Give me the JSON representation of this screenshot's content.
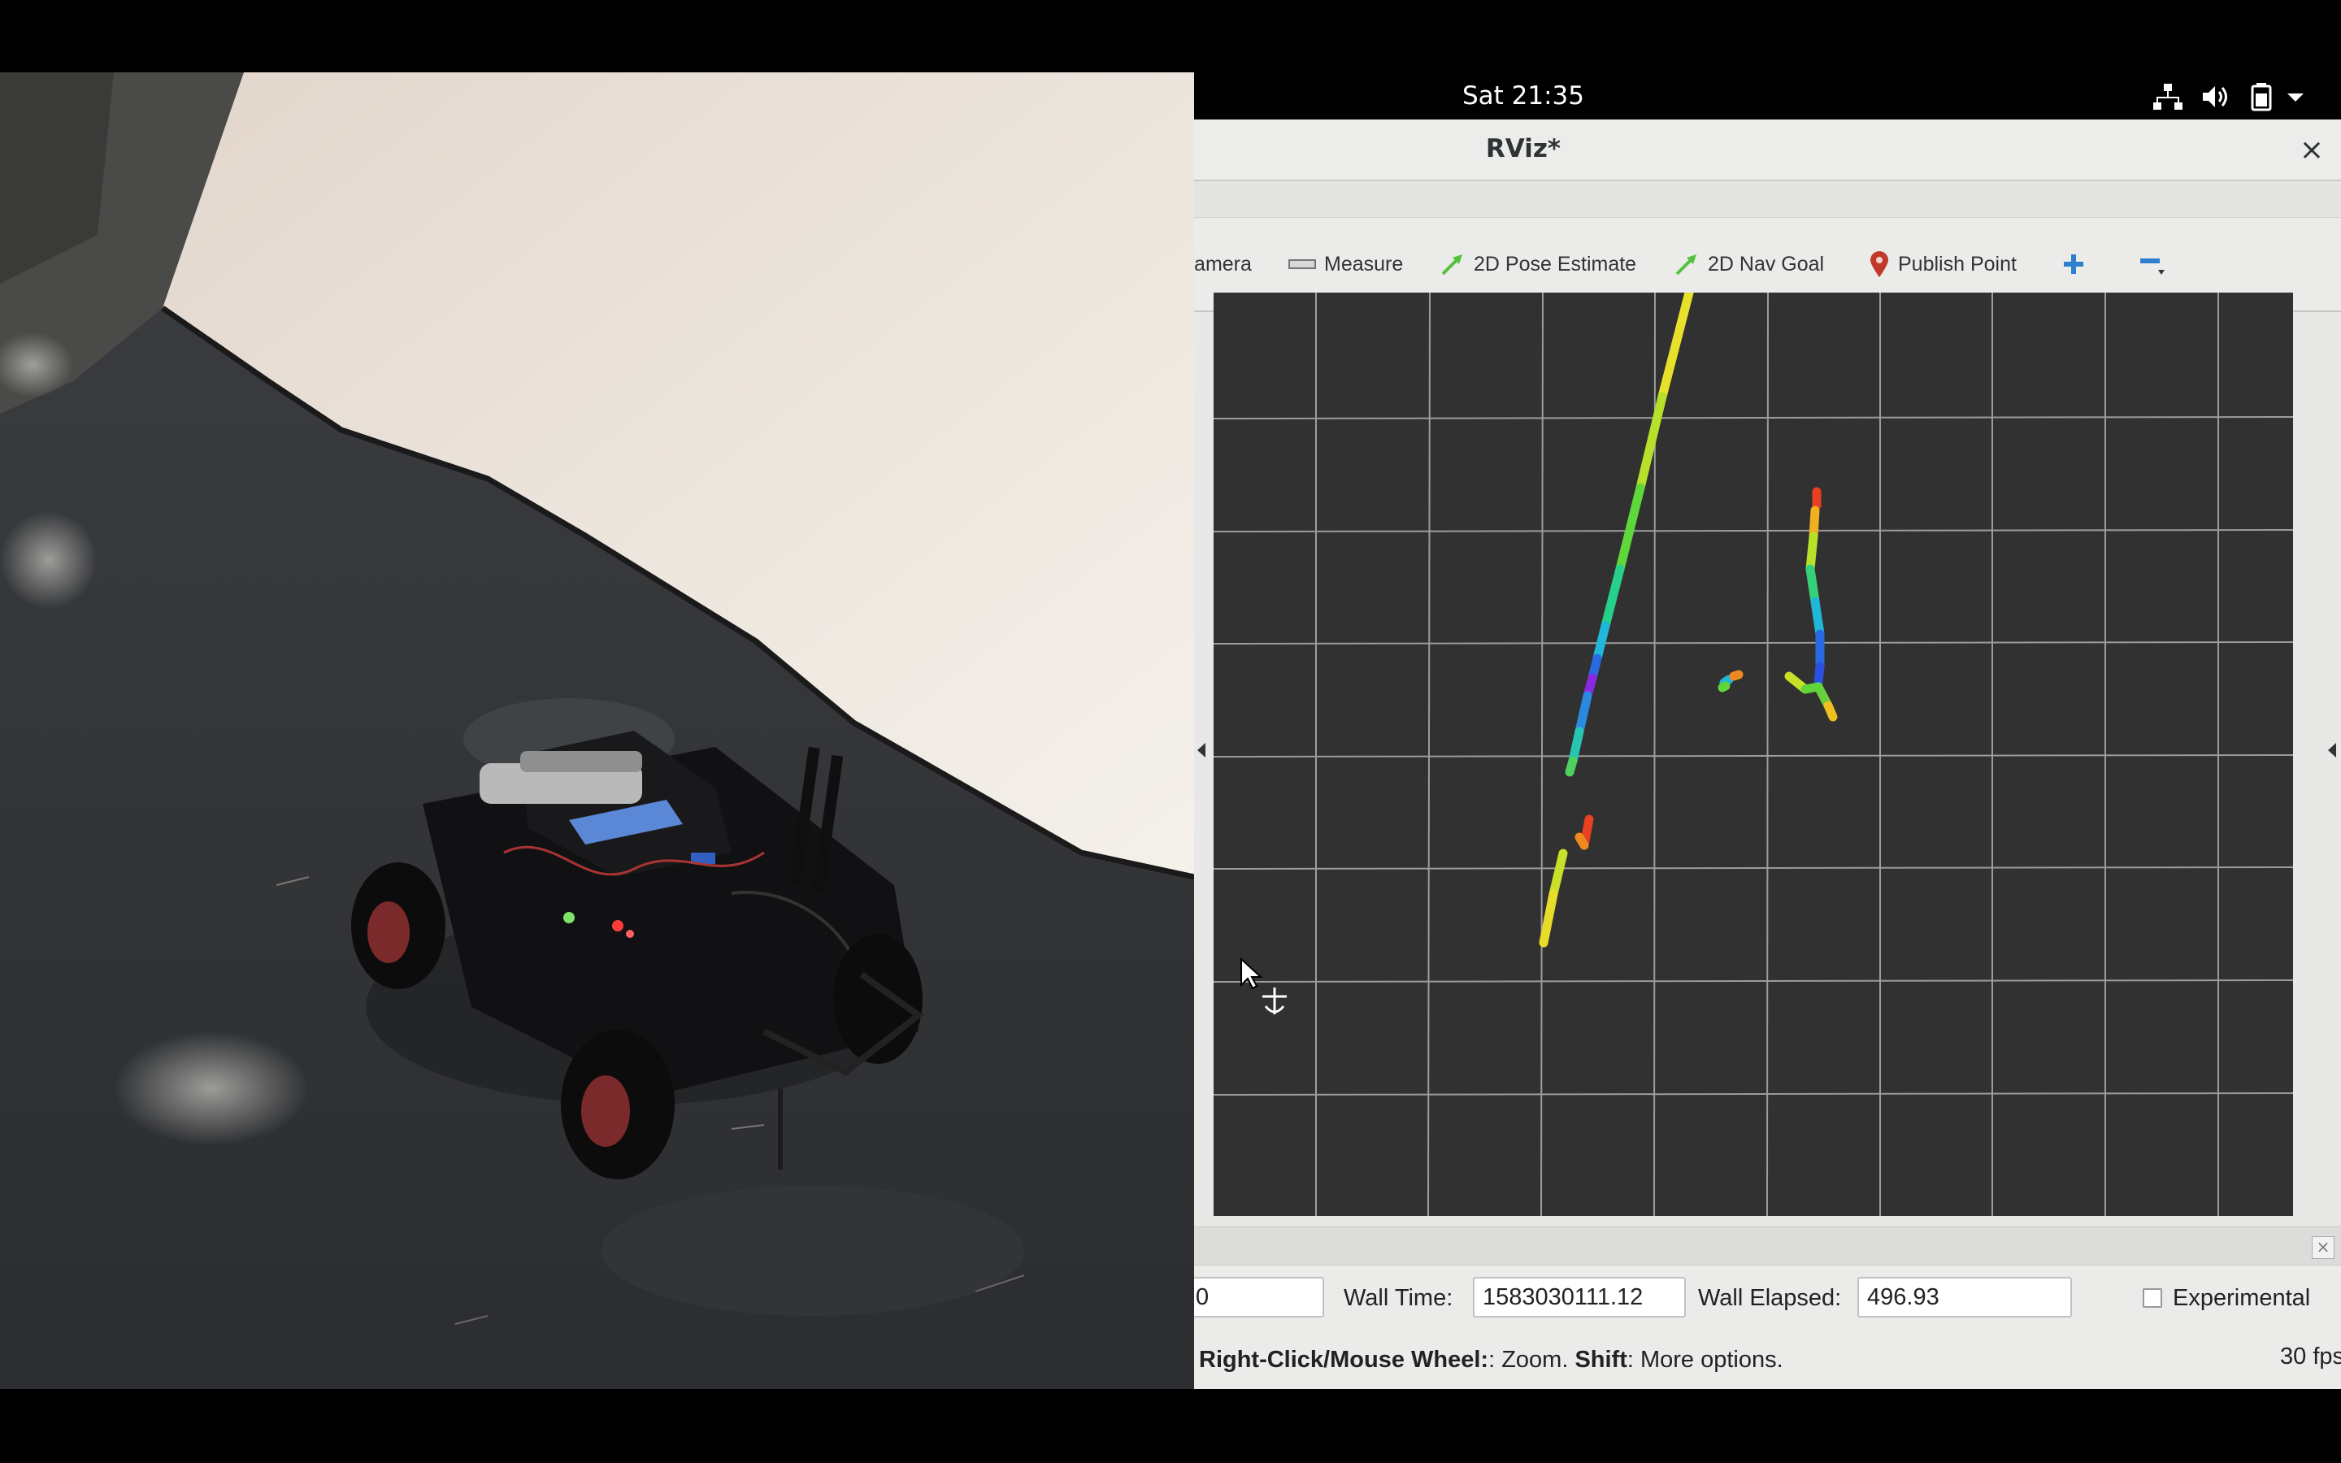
{
  "topbar": {
    "clock": "Sat 21:35",
    "icons": [
      "network-icon",
      "volume-icon",
      "battery-icon",
      "system-menu-arrow-icon"
    ]
  },
  "window": {
    "title": "RViz*"
  },
  "toolbar": {
    "camera_label": "Camera",
    "measure_label": "Measure",
    "pose_estimate_label": "2D Pose Estimate",
    "nav_goal_label": "2D Nav Goal",
    "publish_point_label": "Publish Point"
  },
  "colors": {
    "viewport_bg": "#313131",
    "grid": "#a0a0a0",
    "pose_arrow": "#55c23c",
    "publish_point": "#c0392b",
    "add_tool": "#2f7fd0"
  },
  "time_panel": {
    "ros_time_value": "0",
    "wall_time_label": "Wall Time:",
    "wall_time_value": "1583030111.12",
    "wall_elapsed_label": "Wall Elapsed:",
    "wall_elapsed_value": "496.93",
    "experimental_label": "Experimental",
    "experimental_checked": false
  },
  "status": {
    "hint_bold": "Right-Click/Mouse Wheel:",
    "hint_rest": ": Zoom. ",
    "shift_bold": "Shift",
    "shift_rest": ": More options.",
    "fps": "30 fps"
  }
}
